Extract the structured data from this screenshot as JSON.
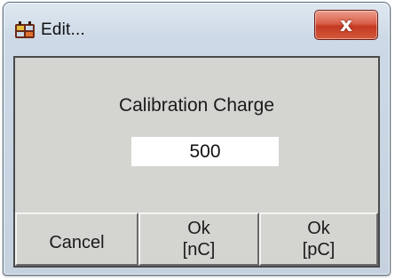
{
  "window": {
    "title": "Edit...",
    "icon": "app-icon",
    "close_label": "x"
  },
  "dialog": {
    "heading": "Calibration Charge",
    "value": "500"
  },
  "buttons": {
    "cancel": "Cancel",
    "ok_nc_line1": "Ok",
    "ok_nc_line2": "[nC]",
    "ok_pc_line1": "Ok",
    "ok_pc_line2": "[pC]"
  },
  "colors": {
    "client_background": "#d4d4d0",
    "close_button": "#c43a22"
  }
}
